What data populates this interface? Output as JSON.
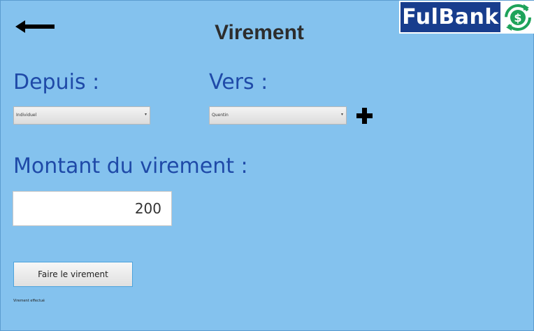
{
  "header": {
    "title": "Virement",
    "logo_text": "FulBank",
    "logo_symbol": "$"
  },
  "icons": {
    "back": "arrow-left-icon",
    "add": "plus-icon",
    "logo": "dollar-cycle-icon",
    "dropdown": "chevron-down-icon"
  },
  "from": {
    "label": "Depuis :",
    "selected": "Individuel",
    "arrow": "▾"
  },
  "to": {
    "label": "Vers :",
    "selected": "Quentin",
    "arrow": "▾"
  },
  "amount": {
    "label": "Montant du virement :",
    "value": "200"
  },
  "actions": {
    "submit_label": "Faire le virement"
  },
  "status": {
    "message": "Virement effectué"
  },
  "colors": {
    "background": "#84c2ee",
    "label_blue": "#1f4aa8",
    "logo_navy": "#183d8d",
    "logo_green": "#1ea35a"
  }
}
